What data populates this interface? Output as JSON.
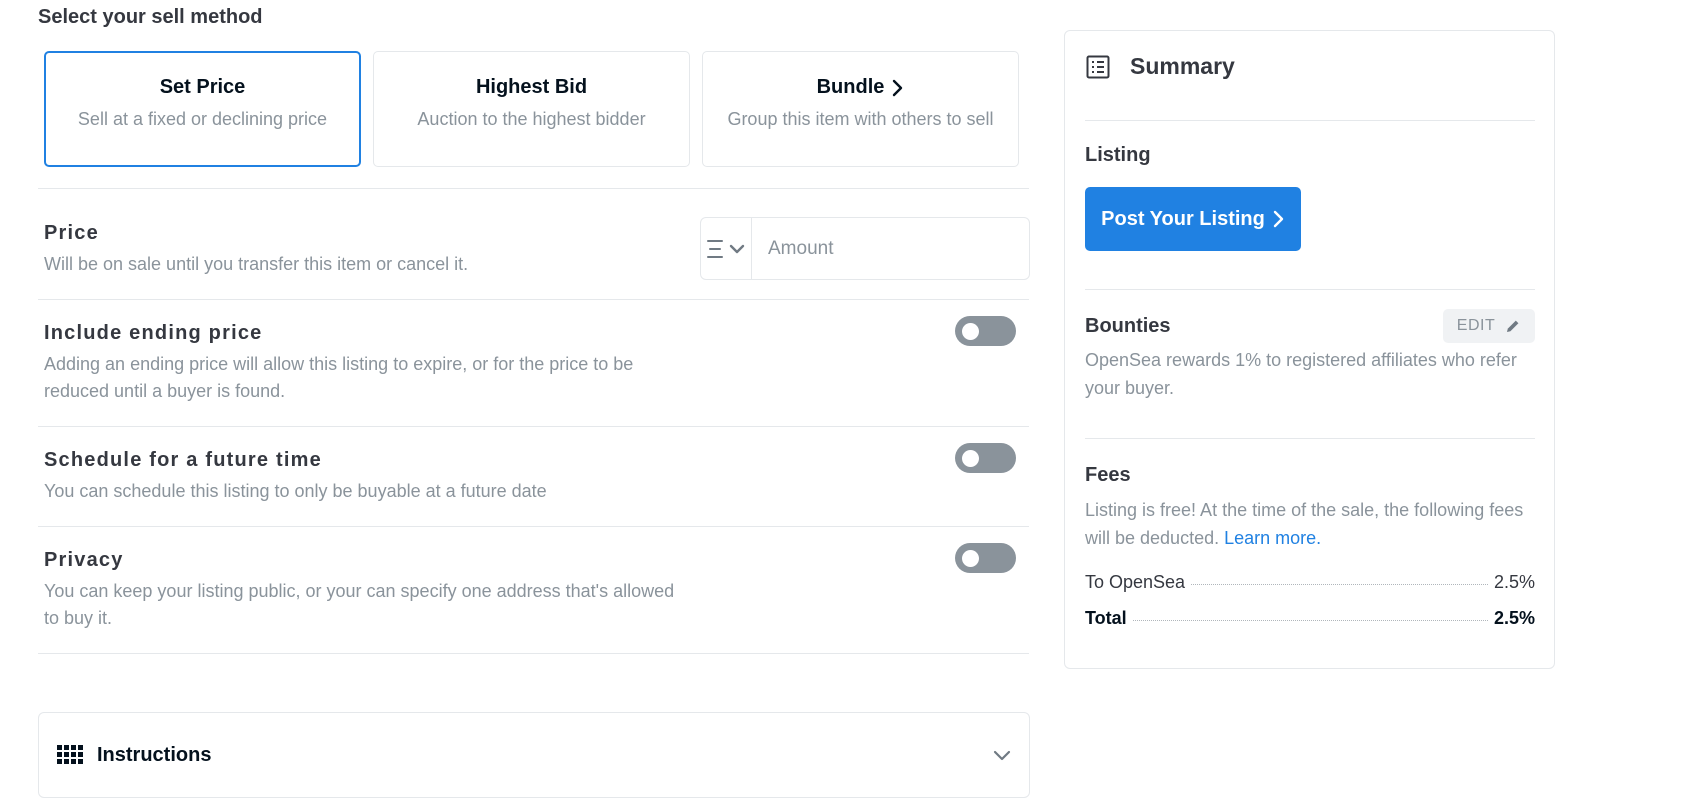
{
  "sell_method": {
    "title": "Select your sell method",
    "options": [
      {
        "label": "Set Price",
        "sub": "Sell at a fixed or declining price",
        "selected": true
      },
      {
        "label": "Highest Bid",
        "sub": "Auction to the highest bidder",
        "selected": false
      },
      {
        "label": "Bundle",
        "sub": "Group this item with others to sell",
        "selected": false
      }
    ]
  },
  "price": {
    "title": "Price",
    "desc": "Will be on sale until you transfer this item or cancel it.",
    "currency_icon": "eth-icon",
    "amount_placeholder": "Amount",
    "amount_value": ""
  },
  "ending_price": {
    "title": "Include ending price",
    "desc": "Adding an ending price will allow this listing to expire, or for the price to be reduced until a buyer is found.",
    "enabled": false
  },
  "schedule": {
    "title": "Schedule for a future time",
    "desc": "You can schedule this listing to only be buyable at a future date",
    "enabled": false
  },
  "privacy": {
    "title": "Privacy",
    "desc": "You can keep your listing public, or your can specify one address that's allowed to buy it.",
    "enabled": false
  },
  "instructions": {
    "label": "Instructions"
  },
  "summary": {
    "title": "Summary",
    "listing_label": "Listing",
    "post_button": "Post Your Listing",
    "bounties_label": "Bounties",
    "edit_label": "EDIT",
    "bounties_text": "OpenSea rewards 1% to registered affiliates who refer your buyer.",
    "fees_label": "Fees",
    "fees_text": "Listing is free! At the time of the sale, the following fees will be deducted.",
    "learn_more": "Learn more.",
    "fee_rows": [
      {
        "label": "To OpenSea",
        "value": "2.5%"
      },
      {
        "label": "Total",
        "value": "2.5%"
      }
    ]
  },
  "colors": {
    "accent": "#2081e2",
    "toggle_off": "#8a939b",
    "border": "#e5e8eb"
  }
}
